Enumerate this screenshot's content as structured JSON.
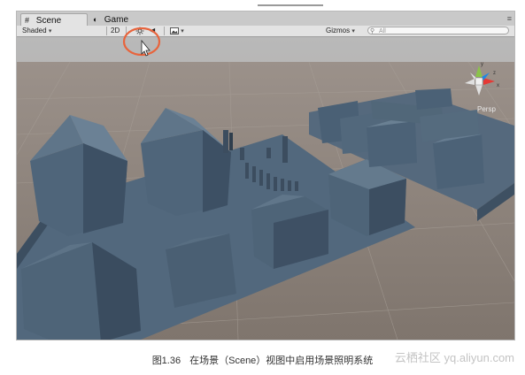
{
  "tabs": [
    {
      "label": "Scene",
      "icon": "grid-icon",
      "active": true
    },
    {
      "label": "Game",
      "icon": "pacman-icon",
      "active": false
    }
  ],
  "toolbar": {
    "shading_mode": "Shaded",
    "mode_2d": "2D",
    "lighting_icon": "sun-icon",
    "audio_icon": "speaker-icon",
    "effects_icon": "image-icon",
    "gizmos_label": "Gizmos",
    "search_placeholder": "All"
  },
  "gizmo": {
    "projection_label": "Persp",
    "axis_labels": [
      "y",
      "z",
      "x"
    ]
  },
  "caption": {
    "number": "图1.36",
    "text": "在场景（Scene）视图中启用场景照明系统"
  },
  "watermark": "云栖社区 yq.aliyun.com",
  "colors": {
    "sky": "#bcbcbc",
    "ground": "#8a7f76",
    "buildings": "#4a6177",
    "highlight_ring": "#e8643c"
  }
}
